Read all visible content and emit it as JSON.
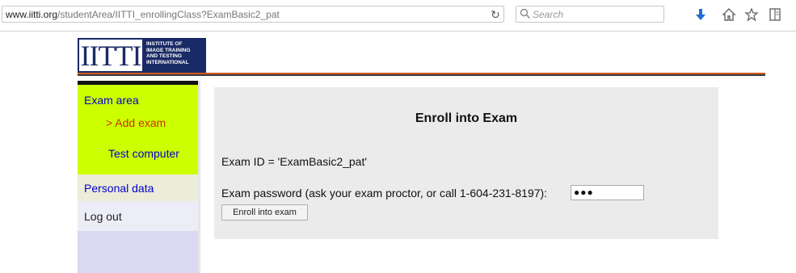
{
  "browser": {
    "url_domain": "www.iitti.org",
    "url_path": "/studentArea/IITTI_enrollingClass?ExamBasic2_pat",
    "search_placeholder": "Search"
  },
  "logo": {
    "wordmark": "IITTI",
    "subtitle_lines": [
      "INSTITUTE OF",
      "IMAGE TRAINING",
      "AND TESTING",
      "INTERNATIONAL"
    ]
  },
  "sidebar": {
    "exam_area": "Exam area",
    "add_exam": "> Add exam",
    "test_computer": "Test computer",
    "personal_data": "Personal data",
    "log_out": "Log out"
  },
  "main": {
    "title": "Enroll into Exam",
    "exam_id": "Exam ID = 'ExamBasic2_pat'",
    "password_label": "Exam password (ask your exam proctor, or call 1-604-231-8197):",
    "password_value": "●●●",
    "enroll_button": "Enroll into exam"
  },
  "colors": {
    "brand_navy": "#1a2a66",
    "exam_area_bg": "#ccff00",
    "link": "#0000cc",
    "current_link": "#cc3300",
    "header_rule": "#d35a1f"
  }
}
